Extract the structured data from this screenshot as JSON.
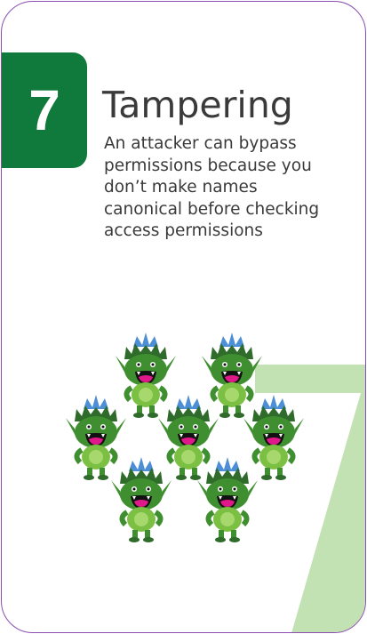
{
  "card": {
    "number": "7",
    "title": "Tampering",
    "description": "An attacker can bypass permissions because you don’t make names canonical before checking access permissions",
    "monster_count": 7
  },
  "colors": {
    "badge": "#0f7a3c",
    "border": "#8a4fb0",
    "watermark": "#c3e2b4",
    "monster_body": "#7cc043",
    "monster_dark": "#2f6b2a",
    "crown": "#4c8fd6",
    "mouth": "#e0198a"
  }
}
